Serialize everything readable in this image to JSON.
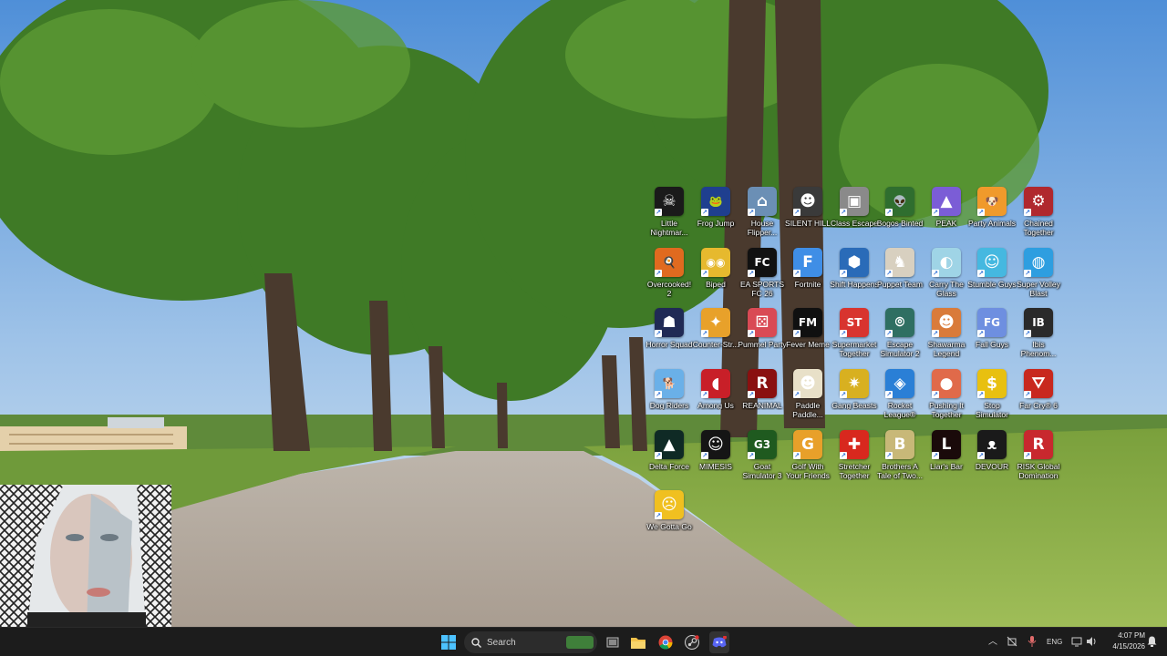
{
  "desktop": {
    "icons": [
      {
        "label": "Little Nightmar...",
        "color": "#1a1a1a",
        "glyph": "☠"
      },
      {
        "label": "Frog Jump",
        "color": "#1f3f8f",
        "glyph": "🐸"
      },
      {
        "label": "House Flipper...",
        "color": "#6b8fb5",
        "glyph": "⌂"
      },
      {
        "label": "SILENT HILL",
        "color": "#3a3a3a",
        "glyph": "☻"
      },
      {
        "label": "Class Escape",
        "color": "#8a8a8a",
        "glyph": "▣"
      },
      {
        "label": "Bogos Binted",
        "color": "#2f6e2f",
        "glyph": "👽"
      },
      {
        "label": "PEAK",
        "color": "#7b5dd6",
        "glyph": "▲"
      },
      {
        "label": "Party Animals",
        "color": "#f09a2b",
        "glyph": "🐶"
      },
      {
        "label": "Chained Together",
        "color": "#b0282e",
        "glyph": "⚙"
      },
      {
        "label": "Overcooked! 2",
        "color": "#e06a1f",
        "glyph": "🍳"
      },
      {
        "label": "Biped",
        "color": "#e6b92e",
        "glyph": "◉◉"
      },
      {
        "label": "EA SPORTS FC 26",
        "color": "#111111",
        "glyph": "FC"
      },
      {
        "label": "Fortnite",
        "color": "#3f8ee6",
        "glyph": "F"
      },
      {
        "label": "Shift Happens",
        "color": "#2a6bb8",
        "glyph": "⬢"
      },
      {
        "label": "Puppet Team",
        "color": "#d8d0c0",
        "glyph": "♞"
      },
      {
        "label": "Carry The Glass",
        "color": "#9fd4e6",
        "glyph": "◐"
      },
      {
        "label": "Stumble Guys",
        "color": "#45b8e0",
        "glyph": "☺"
      },
      {
        "label": "Super Volley Blast",
        "color": "#2e9ee0",
        "glyph": "◍"
      },
      {
        "label": "Horror Squad",
        "color": "#202a55",
        "glyph": "☗"
      },
      {
        "label": "Counter-Str...",
        "color": "#e8a12a",
        "glyph": "✦"
      },
      {
        "label": "Pummel Party",
        "color": "#d94a55",
        "glyph": "⚄"
      },
      {
        "label": "Fever Meme",
        "color": "#101010",
        "glyph": "FM"
      },
      {
        "label": "Supermarket Together",
        "color": "#d8342f",
        "glyph": "ST"
      },
      {
        "label": "Escape Simulator 2",
        "color": "#2f6f62",
        "glyph": "⌾"
      },
      {
        "label": "Shawarma Legend",
        "color": "#d97b3a",
        "glyph": "☻"
      },
      {
        "label": "Fall Guys",
        "color": "#6e8fe0",
        "glyph": "FG"
      },
      {
        "label": "Ibis Phenom...",
        "color": "#2a2a2a",
        "glyph": "IB"
      },
      {
        "label": "Dog Riders",
        "color": "#6ab0e8",
        "glyph": "🐕"
      },
      {
        "label": "Among Us",
        "color": "#c81f28",
        "glyph": "◖"
      },
      {
        "label": "REANIMAL",
        "color": "#8a1010",
        "glyph": "R"
      },
      {
        "label": "Paddle Paddle...",
        "color": "#e8e0c8",
        "glyph": "☻"
      },
      {
        "label": "Gang Beasts",
        "color": "#d8b020",
        "glyph": "✷"
      },
      {
        "label": "Rocket League®",
        "color": "#2a7fd6",
        "glyph": "◈"
      },
      {
        "label": "Pushing It Together",
        "color": "#e06a4a",
        "glyph": "●"
      },
      {
        "label": "Stop Simulator",
        "color": "#e8c010",
        "glyph": "$"
      },
      {
        "label": "Far Cry® 6",
        "color": "#c8281e",
        "glyph": "⛛"
      },
      {
        "label": "Delta Force",
        "color": "#0f2a25",
        "glyph": "▲"
      },
      {
        "label": "MIMESIS",
        "color": "#151515",
        "glyph": "☺"
      },
      {
        "label": "Goat Simulator 3",
        "color": "#1f5a1f",
        "glyph": "G3"
      },
      {
        "label": "Golf With Your Friends",
        "color": "#e8a02a",
        "glyph": "G"
      },
      {
        "label": "Stretcher Together",
        "color": "#d8281e",
        "glyph": "✚"
      },
      {
        "label": "Brothers A Tale of Two...",
        "color": "#c8b878",
        "glyph": "B"
      },
      {
        "label": "Liar's Bar",
        "color": "#1a0a0a",
        "glyph": "L"
      },
      {
        "label": "DEVOUR",
        "color": "#1a1a1a",
        "glyph": "ᴥ"
      },
      {
        "label": "RISK Global Domination",
        "color": "#c8282e",
        "glyph": "R"
      },
      {
        "label": "We Gotta Go",
        "color": "#f0c020",
        "glyph": "☹"
      }
    ]
  },
  "taskbar": {
    "search_placeholder": "Search",
    "pinned": [
      {
        "name": "task-view",
        "color": "#a0a0a0"
      },
      {
        "name": "file-explorer",
        "color": "#f2c24b"
      },
      {
        "name": "chrome",
        "color": "#4285f4"
      },
      {
        "name": "steam",
        "color": "#c0c0c0"
      },
      {
        "name": "discord",
        "color": "#5865f2"
      }
    ],
    "tray": {
      "language": "ENG",
      "time": "4:07 PM",
      "date": "4/15/2026"
    }
  }
}
